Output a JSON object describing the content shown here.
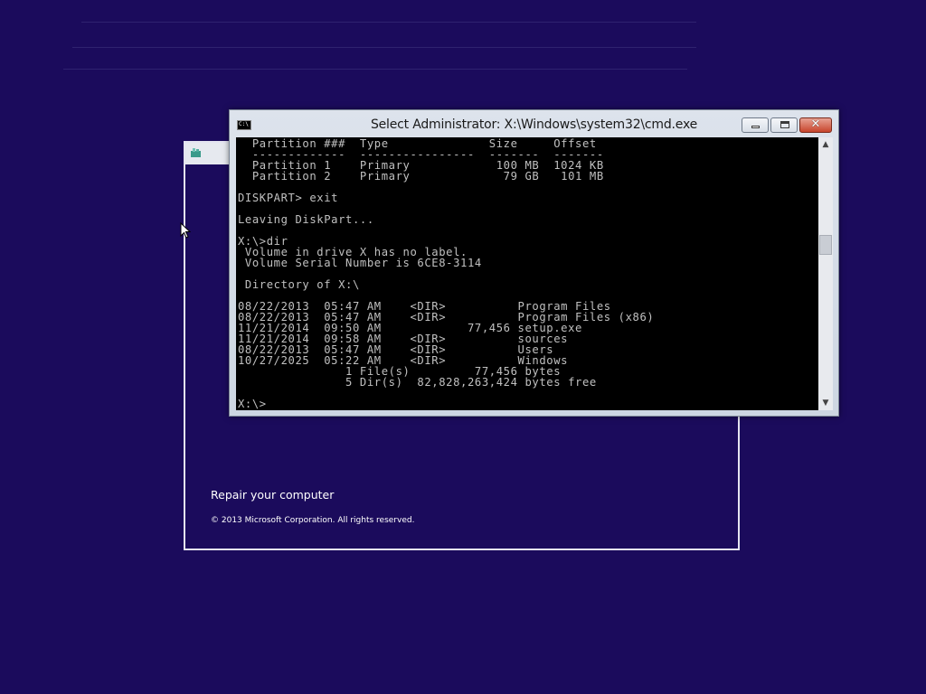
{
  "cmd_window": {
    "title": "Select Administrator: X:\\Windows\\system32\\cmd.exe",
    "icon_text": "C:\\",
    "console_lines": [
      "  Partition ###  Type              Size     Offset",
      "  -------------  ----------------  -------  -------",
      "  Partition 1    Primary            100 MB  1024 KB",
      "  Partition 2    Primary             79 GB   101 MB",
      "",
      "DISKPART> exit",
      "",
      "Leaving DiskPart...",
      "",
      "X:\\>dir",
      " Volume in drive X has no label.",
      " Volume Serial Number is 6CE8-3114",
      "",
      " Directory of X:\\",
      "",
      "08/22/2013  05:47 AM    <DIR>          Program Files",
      "08/22/2013  05:47 AM    <DIR>          Program Files (x86)",
      "11/21/2014  09:50 AM            77,456 setup.exe",
      "11/21/2014  09:58 AM    <DIR>          sources",
      "08/22/2013  05:47 AM    <DIR>          Users",
      "10/27/2025  05:22 AM    <DIR>          Windows",
      "               1 File(s)         77,456 bytes",
      "               5 Dir(s)  82,828,263,424 bytes free",
      "",
      "X:\\>"
    ]
  },
  "setup_window": {
    "repair_link": "Repair your computer",
    "copyright": "© 2013 Microsoft Corporation. All rights reserved."
  },
  "colors": {
    "desktop_background": "#1b0b5c",
    "console_background": "#000000",
    "console_text": "#c0c0c0"
  },
  "icons": {
    "minimize": "minimize-icon",
    "maximize": "maximize-icon",
    "close": "close-icon",
    "scroll_up": "chevron-up-icon",
    "scroll_down": "chevron-down-icon",
    "pointer": "mouse-pointer-icon",
    "setup": "setup-icon"
  }
}
